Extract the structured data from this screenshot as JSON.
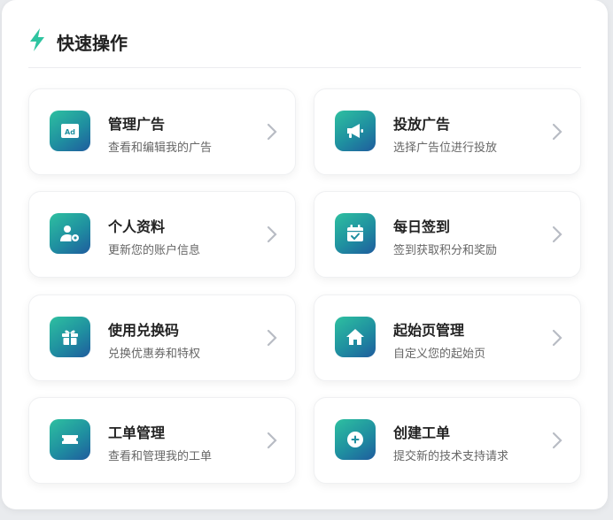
{
  "header": {
    "title": "快速操作",
    "icon": "lightning-icon",
    "accent": "#2ec4a0"
  },
  "cards": [
    {
      "title": "管理广告",
      "desc": "查看和编辑我的广告",
      "icon": "ad-icon"
    },
    {
      "title": "投放广告",
      "desc": "选择广告位进行投放",
      "icon": "megaphone-icon"
    },
    {
      "title": "个人资料",
      "desc": "更新您的账户信息",
      "icon": "user-settings-icon"
    },
    {
      "title": "每日签到",
      "desc": "签到获取积分和奖励",
      "icon": "calendar-check-icon"
    },
    {
      "title": "使用兑换码",
      "desc": "兑换优惠券和特权",
      "icon": "gift-icon"
    },
    {
      "title": "起始页管理",
      "desc": "自定义您的起始页",
      "icon": "home-icon"
    },
    {
      "title": "工单管理",
      "desc": "查看和管理我的工单",
      "icon": "ticket-icon"
    },
    {
      "title": "创建工单",
      "desc": "提交新的技术支持请求",
      "icon": "plus-circle-icon"
    }
  ],
  "colors": {
    "icon_gradient": [
      "#2ec0a0",
      "#1f5c9e"
    ],
    "chevron": "#b8bcc4"
  }
}
